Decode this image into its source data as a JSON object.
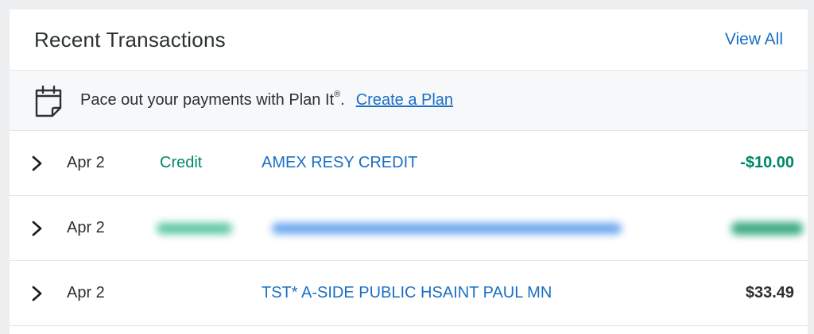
{
  "header": {
    "title": "Recent Transactions",
    "view_all_label": "View All"
  },
  "plan_it": {
    "icon": "calendar-icon",
    "text": "Pace out your payments with Plan It",
    "registered": "®",
    "period": ".",
    "link_label": "Create a Plan"
  },
  "transactions": [
    {
      "date": "Apr 2",
      "type": "Credit",
      "description": "AMEX RESY CREDIT",
      "amount": "-$10.00",
      "is_credit": true
    },
    {
      "date": "Apr 2",
      "type": "",
      "description": "",
      "amount": "",
      "redacted": true
    },
    {
      "date": "Apr 2",
      "type": "",
      "description": "TST* A-SIDE PUBLIC HSAINT PAUL MN",
      "amount": "$33.49",
      "is_credit": false
    }
  ],
  "colors": {
    "link": "#1a6fc4",
    "credit": "#008767",
    "text": "#2b3033",
    "background": "#eceef0"
  }
}
